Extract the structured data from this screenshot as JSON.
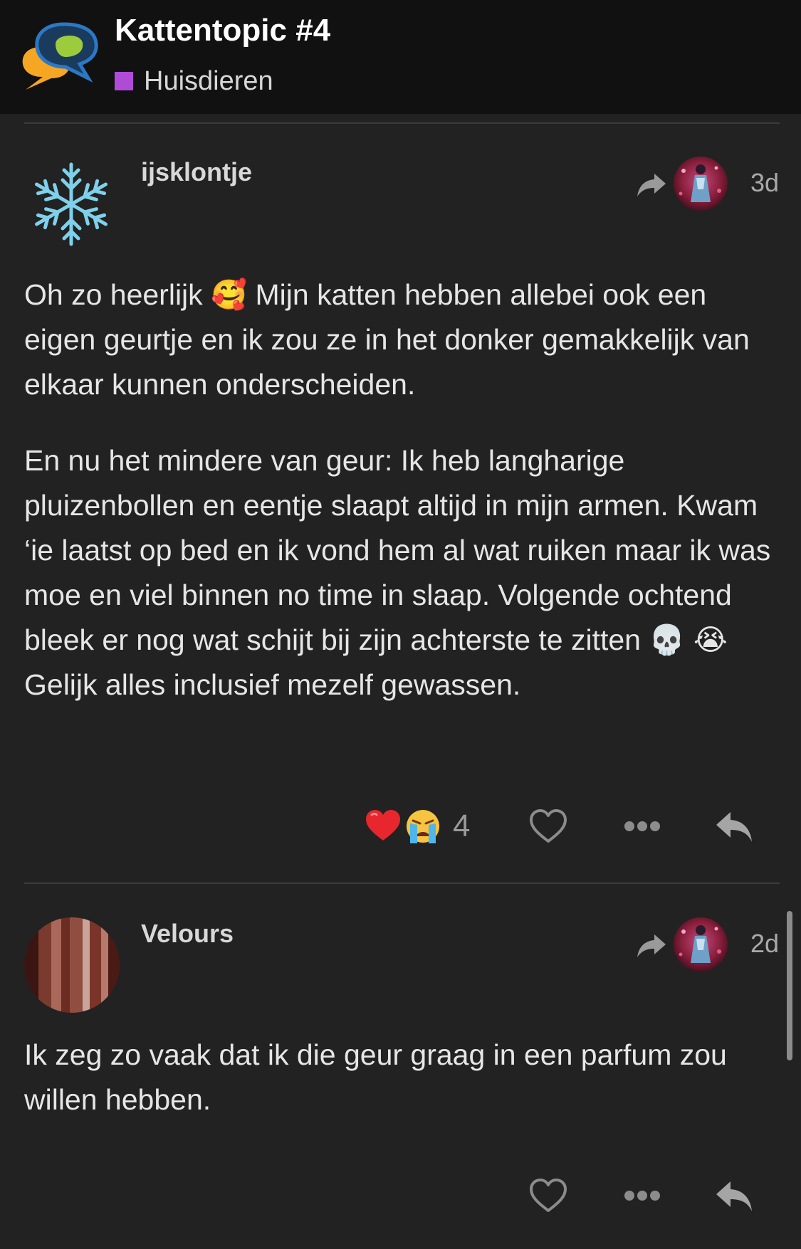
{
  "header": {
    "title": "Kattentopic #4",
    "category": "Huisdieren",
    "category_color": "#b04bd8"
  },
  "posts": [
    {
      "username": "ijsklontje",
      "avatar": "snowflake-icon",
      "date": "3d",
      "paragraphs": [
        [
          "Oh zo heerlijk ",
          "🥰",
          " Mijn katten hebben allebei ook een eigen geurtje en ik zou ze in het donker gemakkelijk van elkaar kunnen onderscheiden."
        ],
        [
          "En nu het mindere van geur: Ik heb langharige pluizenbollen en eentje slaapt altijd in mijn armen. Kwam ‘ie laatst op bed en ik vond hem al wat ruiken maar ik was moe en viel binnen no time in slaap. Volgende ochtend bleek er nog wat schijt bij zijn achterste te zitten ",
          "💀",
          " ",
          "😭",
          " Gelijk alles inclusief mezelf gewassen."
        ]
      ],
      "reactions": [
        "❤️",
        "😭"
      ],
      "reaction_count": "4"
    },
    {
      "username": "Velours",
      "avatar": "curtain-avatar",
      "date": "2d",
      "paragraphs": [
        [
          "Ik zeg zo vaak dat ik die geur graag in een parfum zou willen hebben."
        ]
      ]
    }
  ],
  "icons": {
    "share": "share-arrow-icon",
    "like": "heart-outline-icon",
    "more": "more-dots-icon",
    "reply": "reply-arrow-icon"
  }
}
